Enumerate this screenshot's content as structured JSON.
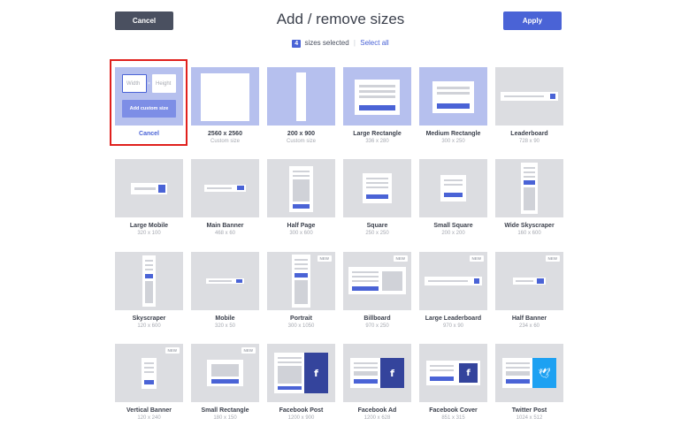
{
  "header": {
    "cancel_label": "Cancel",
    "title": "Add / remove sizes",
    "apply_label": "Apply"
  },
  "selection": {
    "count": "4",
    "text": "sizes selected",
    "separator": "|",
    "select_all": "Select all"
  },
  "custom": {
    "width_placeholder": "Width",
    "x": "×",
    "height_placeholder": "Height",
    "add_label": "Add custom size",
    "cancel_label": "Cancel"
  },
  "new_badge": "NEW",
  "tiles": [
    {
      "name": "2560 x 2560",
      "size": "Custom size",
      "selected": true
    },
    {
      "name": "200 x 900",
      "size": "Custom size",
      "selected": true
    },
    {
      "name": "Large Rectangle",
      "size": "336 x 280",
      "selected": true
    },
    {
      "name": "Medium Rectangle",
      "size": "300 x 250",
      "selected": true
    },
    {
      "name": "Leaderboard",
      "size": "728 x 90"
    },
    {
      "name": "Large Mobile",
      "size": "320 x 100"
    },
    {
      "name": "Main Banner",
      "size": "468 x 60"
    },
    {
      "name": "Half Page",
      "size": "300 x 600"
    },
    {
      "name": "Square",
      "size": "250 x 250"
    },
    {
      "name": "Small Square",
      "size": "200 x 200"
    },
    {
      "name": "Wide Skyscraper",
      "size": "160 x 600"
    },
    {
      "name": "Skyscraper",
      "size": "120 x 600"
    },
    {
      "name": "Mobile",
      "size": "320 x 50"
    },
    {
      "name": "Portrait",
      "size": "300 x 1050",
      "new": true
    },
    {
      "name": "Billboard",
      "size": "970 x 250",
      "new": true
    },
    {
      "name": "Large Leaderboard",
      "size": "970 x 90",
      "new": true
    },
    {
      "name": "Half Banner",
      "size": "234 x 60",
      "new": true
    },
    {
      "name": "Vertical Banner",
      "size": "120 x 240",
      "new": true
    },
    {
      "name": "Small Rectangle",
      "size": "180 x 150",
      "new": true
    },
    {
      "name": "Facebook Post",
      "size": "1200 x 900",
      "icon": "facebook-icon"
    },
    {
      "name": "Facebook Ad",
      "size": "1200 x 628",
      "icon": "facebook-icon"
    },
    {
      "name": "Facebook Cover",
      "size": "851 x 315",
      "icon": "facebook-icon"
    },
    {
      "name": "Twitter Post",
      "size": "1024 x 512",
      "icon": "twitter-icon"
    }
  ],
  "colors": {
    "accent": "#4a63d6",
    "selected_tile": "#b6c0ee",
    "tile": "#dcdde1",
    "highlight": "#e0201d"
  }
}
